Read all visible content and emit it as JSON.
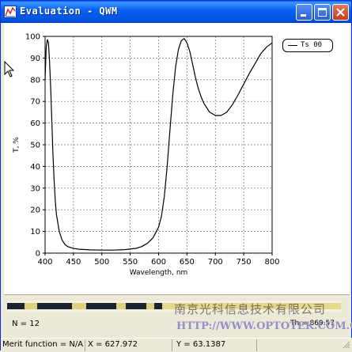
{
  "window": {
    "title": "Evaluation - QWM",
    "app_icon": "plot-window-icon",
    "controls": [
      "minimize-icon",
      "maximize-icon",
      "close-icon"
    ]
  },
  "plot": {
    "legend_label": "Ts 00"
  },
  "chart_data": {
    "type": "line",
    "title": "",
    "xlabel": "Wavelength, nm",
    "ylabel": "T, %",
    "xlim": [
      400,
      800
    ],
    "ylim": [
      0,
      100
    ],
    "x_ticks": [
      400,
      450,
      500,
      550,
      600,
      650,
      700,
      750,
      800
    ],
    "y_ticks": [
      0,
      10,
      20,
      30,
      40,
      50,
      60,
      70,
      80,
      90,
      100
    ],
    "grid": true,
    "legend_position": "top-right",
    "series": [
      {
        "name": "Ts 00",
        "color": "#000000",
        "x": [
          400,
          402,
          404,
          406,
          408,
          410,
          412,
          414,
          416,
          418,
          420,
          425,
          430,
          435,
          440,
          450,
          460,
          480,
          500,
          520,
          540,
          560,
          570,
          580,
          590,
          600,
          605,
          610,
          615,
          620,
          625,
          630,
          635,
          640,
          645,
          650,
          655,
          660,
          665,
          670,
          675,
          680,
          690,
          700,
          710,
          720,
          730,
          740,
          750,
          760,
          770,
          780,
          790,
          800
        ],
        "y": [
          80,
          95,
          98.5,
          97,
          88,
          75,
          60,
          45,
          33,
          24,
          18,
          10,
          6,
          4,
          3,
          2.2,
          1.8,
          1.5,
          1.4,
          1.4,
          1.6,
          2.2,
          3,
          4.5,
          7,
          12,
          17,
          26,
          40,
          57,
          73,
          86,
          94,
          98,
          99,
          97,
          93,
          87,
          81,
          76,
          72,
          69,
          65,
          63.5,
          63.5,
          65,
          68.5,
          73,
          78,
          83,
          87.5,
          92,
          95,
          97
        ]
      }
    ]
  },
  "lower_panel": {
    "n_label": "N = 12",
    "th_label": "Th = 869.57",
    "watermark_company": "南京光科信息技术有限公司",
    "watermark_url": "HTTP://WWW.OPTOTEK.COM.CN"
  },
  "status_bar": {
    "merit": "Merit function = N/A",
    "x": "X = 627.972",
    "y": "Y = 63.1387"
  }
}
